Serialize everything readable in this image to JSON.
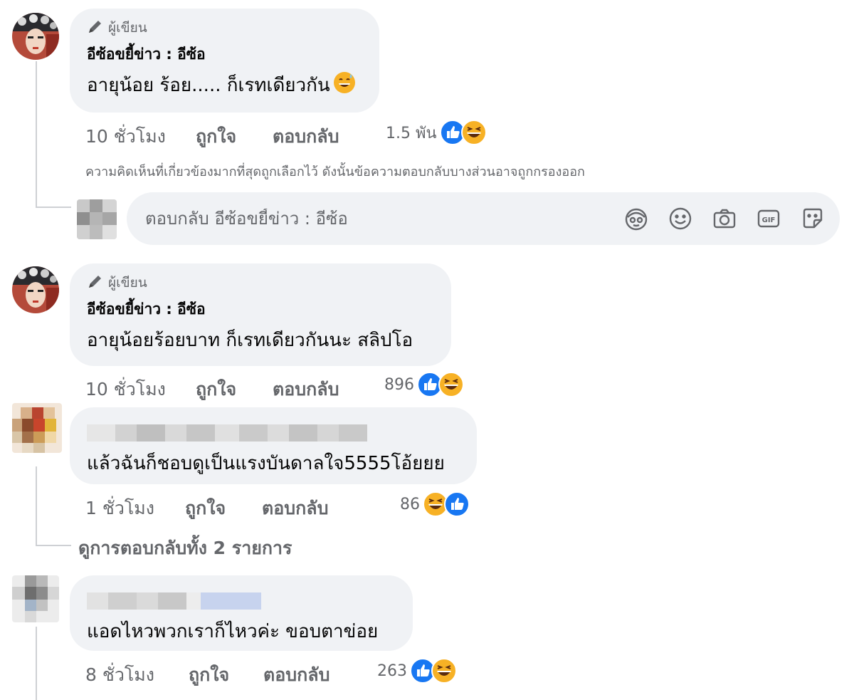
{
  "comments": [
    {
      "author_badge": "ผู้เขียน",
      "author": "อีซ้อขยี้ข่าว : อีซ้อ",
      "text": "อายุน้อย ร้อย..... ก็เรทเดียวกัน",
      "emoji": "grinning-sweat-emoji",
      "time": "10 ชั่วโมง",
      "like_label": "ถูกใจ",
      "reply_label": "ตอบกลับ",
      "reaction_count": "1.5 พัน",
      "reactions": [
        "like-reaction-icon",
        "haha-reaction-icon"
      ]
    },
    {
      "author_badge": "ผู้เขียน",
      "author": "อีซ้อขยี้ข่าว : อีซ้อ",
      "text": "อายุน้อยร้อยบาท ก็เรทเดียวกันนะ สลิปโอ",
      "time": "10 ชั่วโมง",
      "like_label": "ถูกใจ",
      "reply_label": "ตอบกลับ",
      "reaction_count": "896",
      "reactions": [
        "like-reaction-icon",
        "haha-reaction-icon"
      ]
    },
    {
      "author": "",
      "text": "แล้วฉันก็ชอบดูเป็นแรงบันดาลใจ5555โอ้ยยย",
      "time": "1 ชั่วโมง",
      "like_label": "ถูกใจ",
      "reply_label": "ตอบกลับ",
      "reaction_count": "86",
      "reactions": [
        "haha-reaction-icon",
        "like-reaction-icon"
      ]
    },
    {
      "author": "",
      "text": "แอดไหวพวกเราก็ไหวค่ะ ขอบตาข่อย",
      "time": "8 ชั่วโมง",
      "like_label": "ถูกใจ",
      "reply_label": "ตอบกลับ",
      "reaction_count": "263",
      "reactions": [
        "like-reaction-icon",
        "haha-reaction-icon"
      ]
    }
  ],
  "relevance_notice": "ความคิดเห็นที่เกี่ยวข้องมากที่สุดถูกเลือกไว้ ดังนั้นข้อความตอบกลับบางส่วนอาจถูกกรองออก",
  "reply_box": {
    "placeholder": "ตอบกลับ อีซ้อขยี้ข่าว : อีซ้อ",
    "tools": [
      "avatar-sticker-icon",
      "emoji-icon",
      "camera-icon",
      "gif-icon",
      "sticker-icon"
    ]
  },
  "view_replies": "ดูการตอบกลับทั้ง 2 รายการ",
  "colors": {
    "bubble": "#f0f2f5",
    "meta_text": "#65676b",
    "like_blue": "#1877f2",
    "haha_yellow": "#f7b125"
  }
}
